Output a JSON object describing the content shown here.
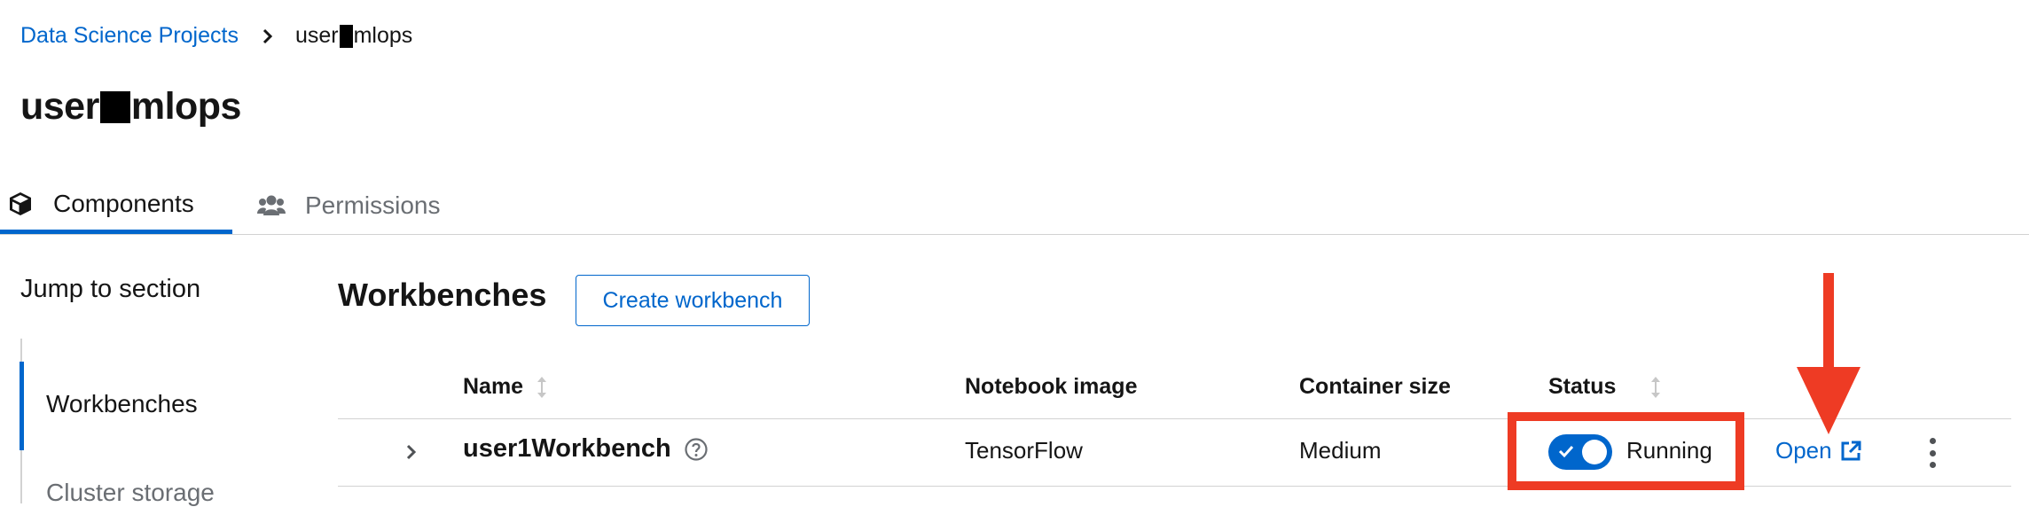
{
  "breadcrumb": {
    "root_label": "Data Science Projects",
    "current_prefix": "user",
    "current_suffix": "mlops"
  },
  "page_title": {
    "prefix": "user",
    "suffix": "mlops"
  },
  "tabs": [
    {
      "label": "Components",
      "icon": "cube-icon",
      "active": true
    },
    {
      "label": "Permissions",
      "icon": "users-icon",
      "active": false
    }
  ],
  "jump_to_section": {
    "title": "Jump to section",
    "items": [
      {
        "label": "Workbenches",
        "active": true
      },
      {
        "label": "Cluster storage",
        "active": false
      }
    ]
  },
  "workbenches": {
    "title": "Workbenches",
    "create_label": "Create workbench",
    "columns": {
      "name": "Name",
      "notebook_image": "Notebook image",
      "container_size": "Container size",
      "status": "Status"
    },
    "rows": [
      {
        "name": "user1Workbench",
        "notebook_image": "TensorFlow",
        "container_size": "Medium",
        "status": "Running",
        "running": true,
        "open_label": "Open"
      }
    ]
  },
  "colors": {
    "link": "#0066cc",
    "annotation": "#ee3b24",
    "toggle_on": "#0066cc"
  },
  "annotations": [
    {
      "type": "highlight-box",
      "target": "status",
      "color": "#ee3b24"
    },
    {
      "type": "arrow-down",
      "target": "open-link",
      "color": "#ee3b24"
    }
  ]
}
